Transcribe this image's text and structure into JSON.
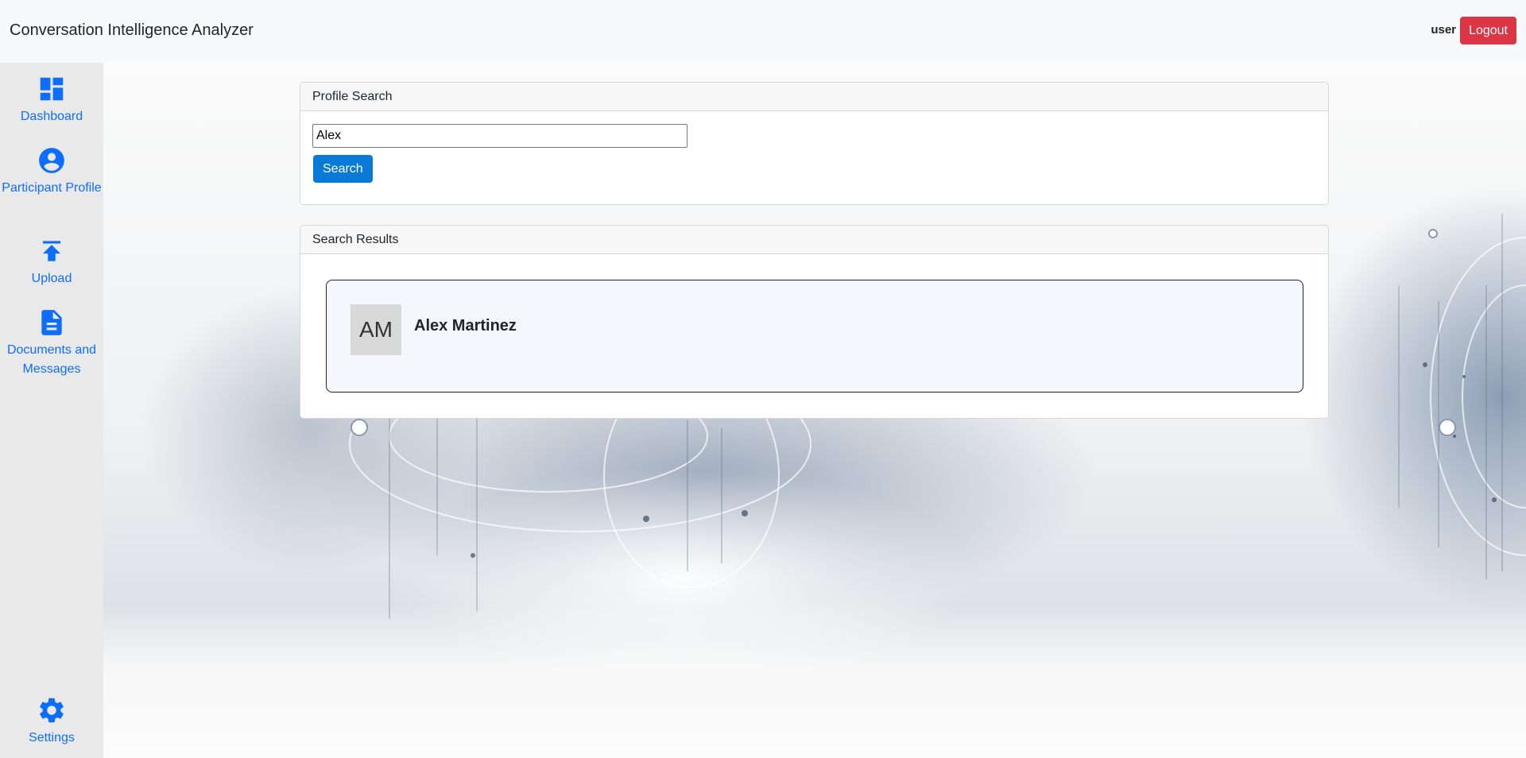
{
  "app": {
    "title": "Conversation Intelligence Analyzer"
  },
  "header": {
    "user": "user",
    "logout_label": "Logout"
  },
  "sidebar": {
    "items": [
      {
        "label": "Dashboard",
        "icon": "dashboard-icon"
      },
      {
        "label": "Participant Profile",
        "icon": "account-circle-icon"
      },
      {
        "label": "Upload",
        "icon": "upload-icon"
      },
      {
        "label": "Documents and Messages",
        "icon": "document-icon"
      }
    ],
    "settings": {
      "label": "Settings",
      "icon": "gear-icon"
    }
  },
  "profile_search": {
    "title": "Profile Search",
    "query": "Alex",
    "button_label": "Search"
  },
  "search_results": {
    "title": "Search Results",
    "results": [
      {
        "initials": "AM",
        "name": "Alex Martinez"
      }
    ]
  },
  "colors": {
    "accent": "#0d6efd",
    "danger": "#dc3545",
    "search_button": "#0a7ad8"
  }
}
